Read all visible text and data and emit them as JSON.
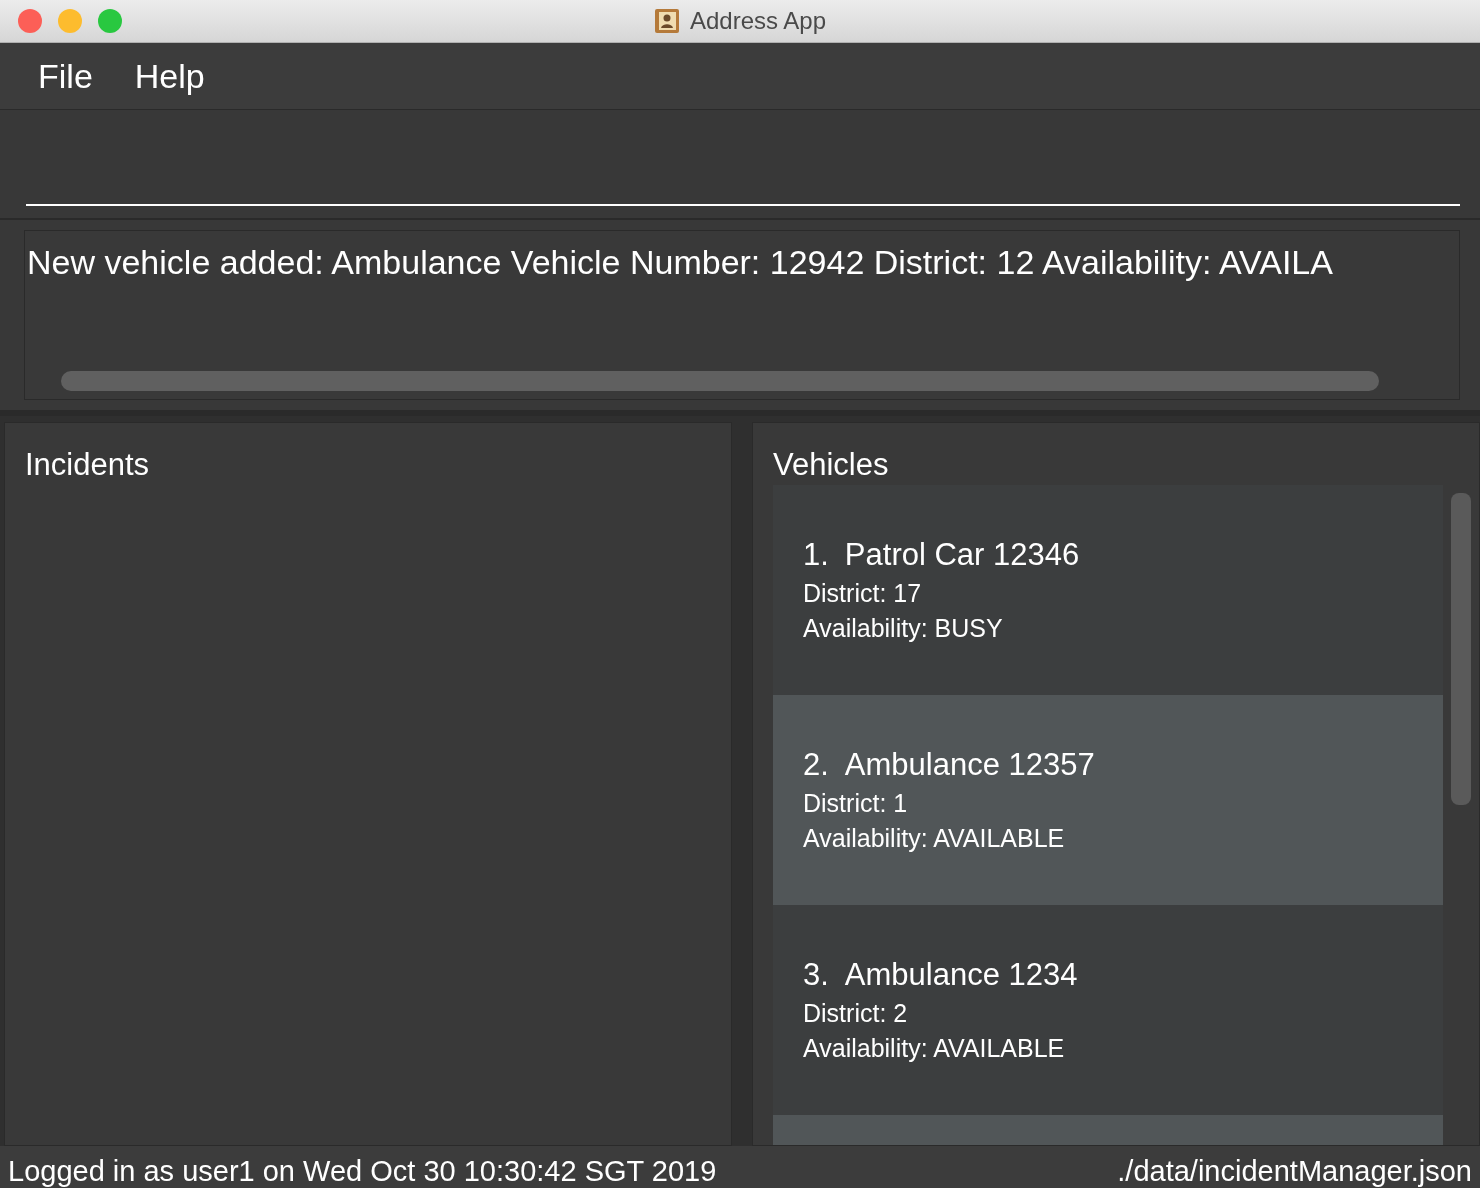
{
  "window": {
    "title": "Address App"
  },
  "menu": [
    "File",
    "Help"
  ],
  "result_display": {
    "text": "New vehicle added: Ambulance Vehicle Number: 12942 District: 12 Availability: AVAILA"
  },
  "incidents": {
    "title": "Incidents"
  },
  "vehicles": {
    "title": "Vehicles",
    "items": [
      {
        "index": "1.",
        "name": "Patrol Car 12346",
        "district": "District: 17",
        "availability": "Availability: BUSY"
      },
      {
        "index": "2.",
        "name": "Ambulance 12357",
        "district": "District: 1",
        "availability": "Availability: AVAILABLE"
      },
      {
        "index": "3.",
        "name": "Ambulance 1234",
        "district": "District: 2",
        "availability": "Availability: AVAILABLE"
      }
    ]
  },
  "status_bar": {
    "left": "Logged in as user1 on Wed Oct 30 10:30:42 SGT 2019",
    "right": "./data/incidentManager.json"
  }
}
